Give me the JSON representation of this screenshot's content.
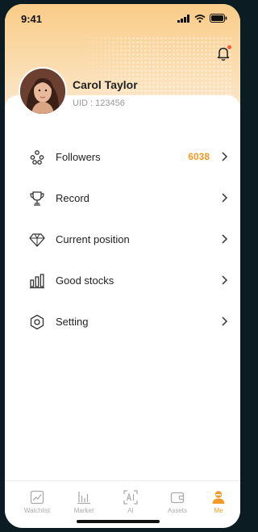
{
  "status_bar": {
    "time": "9:41"
  },
  "profile": {
    "name": "Carol Taylor",
    "uid": "UID : 123456"
  },
  "menu": {
    "followers": {
      "label": "Followers",
      "count": "6038",
      "icon": "followers-icon"
    },
    "record": {
      "label": "Record",
      "icon": "trophy-icon"
    },
    "current_position": {
      "label": "Current position",
      "icon": "diamond-icon"
    },
    "good_stocks": {
      "label": "Good stocks",
      "icon": "bar-chart-icon"
    },
    "setting": {
      "label": "Setting",
      "icon": "hexagon-settings-icon"
    }
  },
  "tabs": [
    {
      "label": "Watchlist",
      "icon": "chart-square-icon"
    },
    {
      "label": "Market",
      "icon": "market-bars-icon"
    },
    {
      "label": "AI",
      "icon": "ai-scan-icon"
    },
    {
      "label": "Assets",
      "icon": "wallet-icon"
    },
    {
      "label": "Me",
      "icon": "person-icon",
      "active": true
    }
  ],
  "colors": {
    "accent": "#f39a24",
    "header_gradient_top": "#f9cc88",
    "notification_dot": "#ff5b3a"
  }
}
